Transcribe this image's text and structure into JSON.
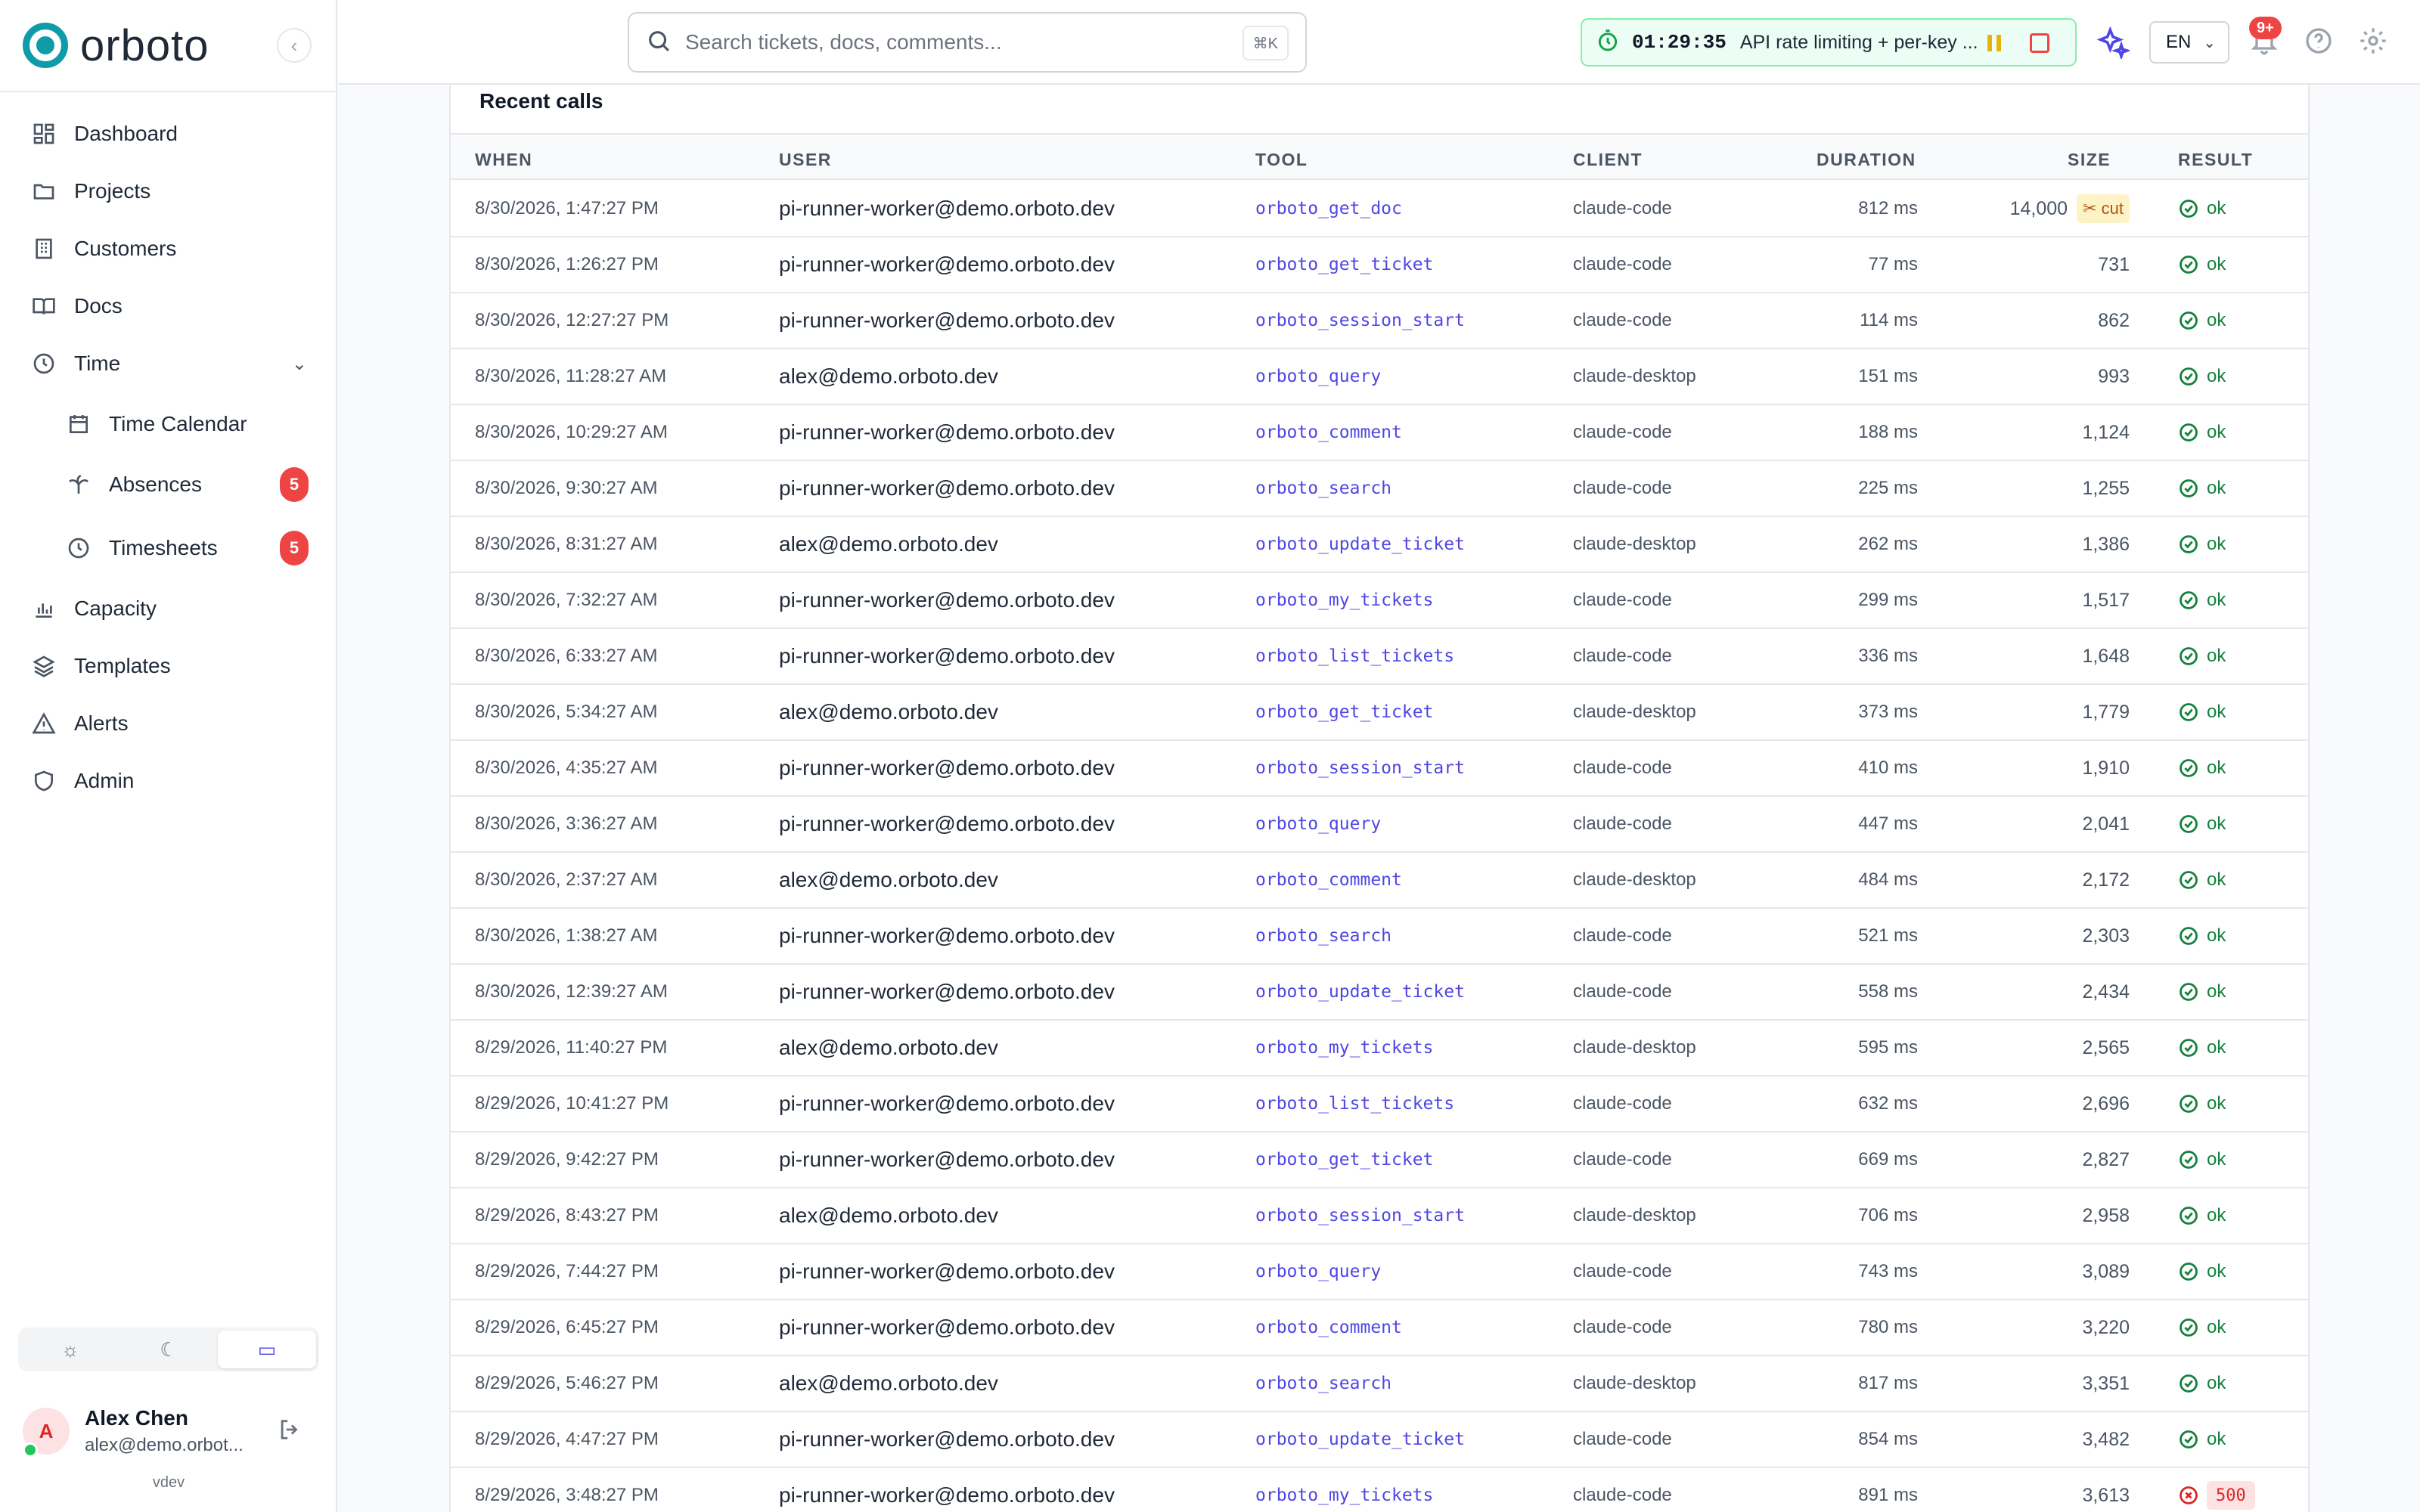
{
  "app": {
    "brand": "orboto"
  },
  "sidebar": {
    "items": [
      {
        "label": "Dashboard",
        "icon": "dashboard-icon"
      },
      {
        "label": "Projects",
        "icon": "folder-icon"
      },
      {
        "label": "Customers",
        "icon": "building-icon"
      },
      {
        "label": "Docs",
        "icon": "book-icon"
      },
      {
        "label": "Time",
        "icon": "clock-icon"
      },
      {
        "label": "Time Calendar",
        "icon": "calendar-icon"
      },
      {
        "label": "Absences",
        "icon": "palm-tree-icon",
        "badge": "5"
      },
      {
        "label": "Timesheets",
        "icon": "clock-icon",
        "badge": "5"
      },
      {
        "label": "Capacity",
        "icon": "bar-chart-icon"
      },
      {
        "label": "Templates",
        "icon": "layers-icon"
      },
      {
        "label": "Alerts",
        "icon": "alert-triangle-icon"
      },
      {
        "label": "Admin",
        "icon": "shield-icon"
      }
    ],
    "theme_options": [
      "light",
      "dark",
      "system"
    ],
    "theme_active": "system",
    "user": {
      "initial": "A",
      "name": "Alex Chen",
      "email": "alex@demo.orbot..."
    },
    "env": "vdev"
  },
  "topbar": {
    "search_placeholder": "Search tickets, docs, comments...",
    "shortcut": "⌘K",
    "timer": {
      "time": "01:29:35",
      "task": "API rate limiting + per-key ..."
    },
    "language": "EN",
    "notifications_badge": "9+"
  },
  "table": {
    "title": "Recent calls",
    "columns": {
      "when": "WHEN",
      "user": "USER",
      "tool": "TOOL",
      "client": "CLIENT",
      "duration": "DURATION",
      "size": "SIZE",
      "result": "RESULT"
    },
    "rows": [
      {
        "when": "8/30/2026, 1:47:27 PM",
        "user": "pi-runner-worker@demo.orboto.dev",
        "tool": "orboto_get_doc",
        "client": "claude-code",
        "duration": "812 ms",
        "size": "14,000",
        "cut": "cut",
        "result": "ok"
      },
      {
        "when": "8/30/2026, 1:26:27 PM",
        "user": "pi-runner-worker@demo.orboto.dev",
        "tool": "orboto_get_ticket",
        "client": "claude-code",
        "duration": "77 ms",
        "size": "731",
        "result": "ok"
      },
      {
        "when": "8/30/2026, 12:27:27 PM",
        "user": "pi-runner-worker@demo.orboto.dev",
        "tool": "orboto_session_start",
        "client": "claude-code",
        "duration": "114 ms",
        "size": "862",
        "result": "ok"
      },
      {
        "when": "8/30/2026, 11:28:27 AM",
        "user": "alex@demo.orboto.dev",
        "tool": "orboto_query",
        "client": "claude-desktop",
        "duration": "151 ms",
        "size": "993",
        "result": "ok"
      },
      {
        "when": "8/30/2026, 10:29:27 AM",
        "user": "pi-runner-worker@demo.orboto.dev",
        "tool": "orboto_comment",
        "client": "claude-code",
        "duration": "188 ms",
        "size": "1,124",
        "result": "ok"
      },
      {
        "when": "8/30/2026, 9:30:27 AM",
        "user": "pi-runner-worker@demo.orboto.dev",
        "tool": "orboto_search",
        "client": "claude-code",
        "duration": "225 ms",
        "size": "1,255",
        "result": "ok"
      },
      {
        "when": "8/30/2026, 8:31:27 AM",
        "user": "alex@demo.orboto.dev",
        "tool": "orboto_update_ticket",
        "client": "claude-desktop",
        "duration": "262 ms",
        "size": "1,386",
        "result": "ok"
      },
      {
        "when": "8/30/2026, 7:32:27 AM",
        "user": "pi-runner-worker@demo.orboto.dev",
        "tool": "orboto_my_tickets",
        "client": "claude-code",
        "duration": "299 ms",
        "size": "1,517",
        "result": "ok"
      },
      {
        "when": "8/30/2026, 6:33:27 AM",
        "user": "pi-runner-worker@demo.orboto.dev",
        "tool": "orboto_list_tickets",
        "client": "claude-code",
        "duration": "336 ms",
        "size": "1,648",
        "result": "ok"
      },
      {
        "when": "8/30/2026, 5:34:27 AM",
        "user": "alex@demo.orboto.dev",
        "tool": "orboto_get_ticket",
        "client": "claude-desktop",
        "duration": "373 ms",
        "size": "1,779",
        "result": "ok"
      },
      {
        "when": "8/30/2026, 4:35:27 AM",
        "user": "pi-runner-worker@demo.orboto.dev",
        "tool": "orboto_session_start",
        "client": "claude-code",
        "duration": "410 ms",
        "size": "1,910",
        "result": "ok"
      },
      {
        "when": "8/30/2026, 3:36:27 AM",
        "user": "pi-runner-worker@demo.orboto.dev",
        "tool": "orboto_query",
        "client": "claude-code",
        "duration": "447 ms",
        "size": "2,041",
        "result": "ok"
      },
      {
        "when": "8/30/2026, 2:37:27 AM",
        "user": "alex@demo.orboto.dev",
        "tool": "orboto_comment",
        "client": "claude-desktop",
        "duration": "484 ms",
        "size": "2,172",
        "result": "ok"
      },
      {
        "when": "8/30/2026, 1:38:27 AM",
        "user": "pi-runner-worker@demo.orboto.dev",
        "tool": "orboto_search",
        "client": "claude-code",
        "duration": "521 ms",
        "size": "2,303",
        "result": "ok"
      },
      {
        "when": "8/30/2026, 12:39:27 AM",
        "user": "pi-runner-worker@demo.orboto.dev",
        "tool": "orboto_update_ticket",
        "client": "claude-code",
        "duration": "558 ms",
        "size": "2,434",
        "result": "ok"
      },
      {
        "when": "8/29/2026, 11:40:27 PM",
        "user": "alex@demo.orboto.dev",
        "tool": "orboto_my_tickets",
        "client": "claude-desktop",
        "duration": "595 ms",
        "size": "2,565",
        "result": "ok"
      },
      {
        "when": "8/29/2026, 10:41:27 PM",
        "user": "pi-runner-worker@demo.orboto.dev",
        "tool": "orboto_list_tickets",
        "client": "claude-code",
        "duration": "632 ms",
        "size": "2,696",
        "result": "ok"
      },
      {
        "when": "8/29/2026, 9:42:27 PM",
        "user": "pi-runner-worker@demo.orboto.dev",
        "tool": "orboto_get_ticket",
        "client": "claude-code",
        "duration": "669 ms",
        "size": "2,827",
        "result": "ok"
      },
      {
        "when": "8/29/2026, 8:43:27 PM",
        "user": "alex@demo.orboto.dev",
        "tool": "orboto_session_start",
        "client": "claude-desktop",
        "duration": "706 ms",
        "size": "2,958",
        "result": "ok"
      },
      {
        "when": "8/29/2026, 7:44:27 PM",
        "user": "pi-runner-worker@demo.orboto.dev",
        "tool": "orboto_query",
        "client": "claude-code",
        "duration": "743 ms",
        "size": "3,089",
        "result": "ok"
      },
      {
        "when": "8/29/2026, 6:45:27 PM",
        "user": "pi-runner-worker@demo.orboto.dev",
        "tool": "orboto_comment",
        "client": "claude-code",
        "duration": "780 ms",
        "size": "3,220",
        "result": "ok"
      },
      {
        "when": "8/29/2026, 5:46:27 PM",
        "user": "alex@demo.orboto.dev",
        "tool": "orboto_search",
        "client": "claude-desktop",
        "duration": "817 ms",
        "size": "3,351",
        "result": "ok"
      },
      {
        "when": "8/29/2026, 4:47:27 PM",
        "user": "pi-runner-worker@demo.orboto.dev",
        "tool": "orboto_update_ticket",
        "client": "claude-code",
        "duration": "854 ms",
        "size": "3,482",
        "result": "ok"
      },
      {
        "when": "8/29/2026, 3:48:27 PM",
        "user": "pi-runner-worker@demo.orboto.dev",
        "tool": "orboto_my_tickets",
        "client": "claude-code",
        "duration": "891 ms",
        "size": "3,613",
        "result": "500"
      }
    ]
  },
  "colors": {
    "brand": "#0f9ba8",
    "accent": "#4f46e5",
    "ok": "#15803d",
    "error": "#dc2626",
    "badge": "#ef4444"
  }
}
